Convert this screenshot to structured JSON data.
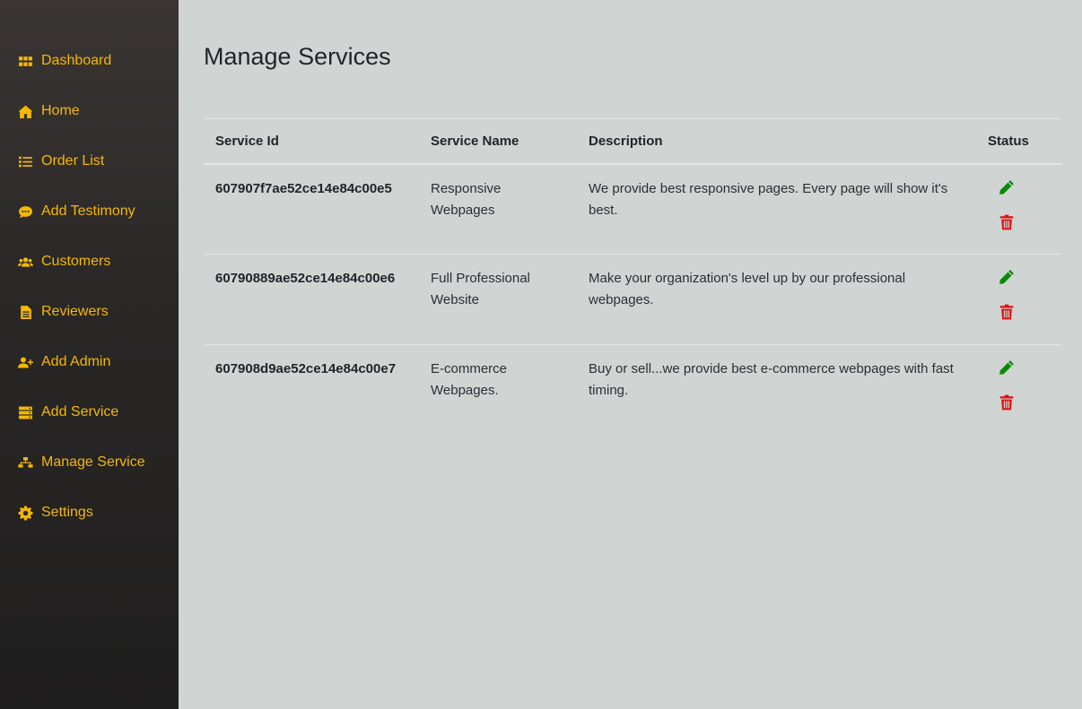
{
  "sidebar": {
    "items": [
      {
        "label": "Dashboard",
        "icon": "grid-icon"
      },
      {
        "label": "Home",
        "icon": "home-icon"
      },
      {
        "label": "Order List",
        "icon": "list-icon"
      },
      {
        "label": "Add Testimony",
        "icon": "comment-icon"
      },
      {
        "label": "Customers",
        "icon": "users-icon"
      },
      {
        "label": "Reviewers",
        "icon": "file-icon"
      },
      {
        "label": "Add Admin",
        "icon": "user-plus-icon"
      },
      {
        "label": "Add Service",
        "icon": "server-icon"
      },
      {
        "label": "Manage Service",
        "icon": "sitemap-icon"
      },
      {
        "label": "Settings",
        "icon": "gear-icon"
      }
    ],
    "accent_color": "#f5b800"
  },
  "main": {
    "title": "Manage Services",
    "table": {
      "headers": [
        "Service Id",
        "Service Name",
        "Description",
        "Status"
      ],
      "rows": [
        {
          "id": "607907f7ae52ce14e84c00e5",
          "name": "Responsive Webpages",
          "description": "We provide best responsive pages. Every page will show it's best."
        },
        {
          "id": "60790889ae52ce14e84c00e6",
          "name": "Full Professional Website",
          "description": "Make your organization's level up by our professional webpages."
        },
        {
          "id": "607908d9ae52ce14e84c00e7",
          "name": "E-commerce Webpages.",
          "description": "Buy or sell...we provide best e-commerce webpages with fast timing."
        }
      ],
      "edit_icon": "pencil-icon",
      "delete_icon": "trash-icon",
      "edit_color": "#0a8a0a",
      "delete_color": "#e01010"
    }
  }
}
